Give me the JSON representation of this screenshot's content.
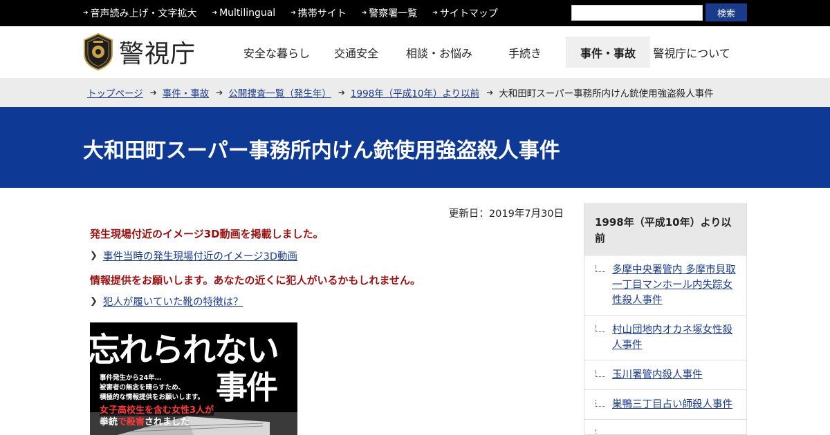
{
  "topbar": {
    "links": [
      "音声読み上げ・文字拡大",
      "Multilingual",
      "携帯サイト",
      "警察署一覧",
      "サイトマップ"
    ],
    "search_placeholder": "",
    "search_button": "検索"
  },
  "header": {
    "logo_text": "警視庁",
    "nav": [
      "安全な暮らし",
      "交通安全",
      "相談・お悩み",
      "手続き",
      "事件・事故",
      "警視庁について"
    ],
    "active_nav": "事件・事故"
  },
  "breadcrumb": {
    "links": [
      "トップページ",
      "事件・事故",
      "公開捜査一覧（発生年）",
      "1998年（平成10年）より以前"
    ],
    "current": "大和田町スーパー事務所内けん銃使用強盗殺人事件"
  },
  "page_title": "大和田町スーパー事務所内けん銃使用強盗殺人事件",
  "main": {
    "updated": "更新日：2019年7月30日",
    "notice1": "発生現場付近のイメージ3D動画を掲載しました。",
    "link1": "事件当時の発生現場付近のイメージ3D動画",
    "notice2": "情報提供をお願いします。あなたの近くに犯人がいるかもしれません。",
    "link2": "犯人が履いていた靴の特徴は？",
    "poster": {
      "headline1": "忘れられない",
      "headline2": "事件",
      "line1": "事件発生から24年…",
      "line2": "被害者の無念を晴らすため、",
      "line3": "積極的な情報提供をお願いします。",
      "red_line": "女子高校生を含む女性3人が",
      "bottom_w1": "拳銃",
      "bottom_r1": "で殺害",
      "bottom_w2": "されました"
    }
  },
  "sidebar": {
    "heading": "1998年（平成10年）より以前",
    "items": [
      "多摩中央署管内 多摩市貝取一丁目マンホール内失踪女性殺人事件",
      "村山団地内オカネ塚女性殺人事件",
      "玉川署管内殺人事件",
      "巣鴨三丁目占い師殺人事件"
    ]
  },
  "colors": {
    "title_band": "#0e3a96",
    "notice_red": "#9a1010",
    "link_blue": "#1a3a8c",
    "topbar": "#000000"
  }
}
